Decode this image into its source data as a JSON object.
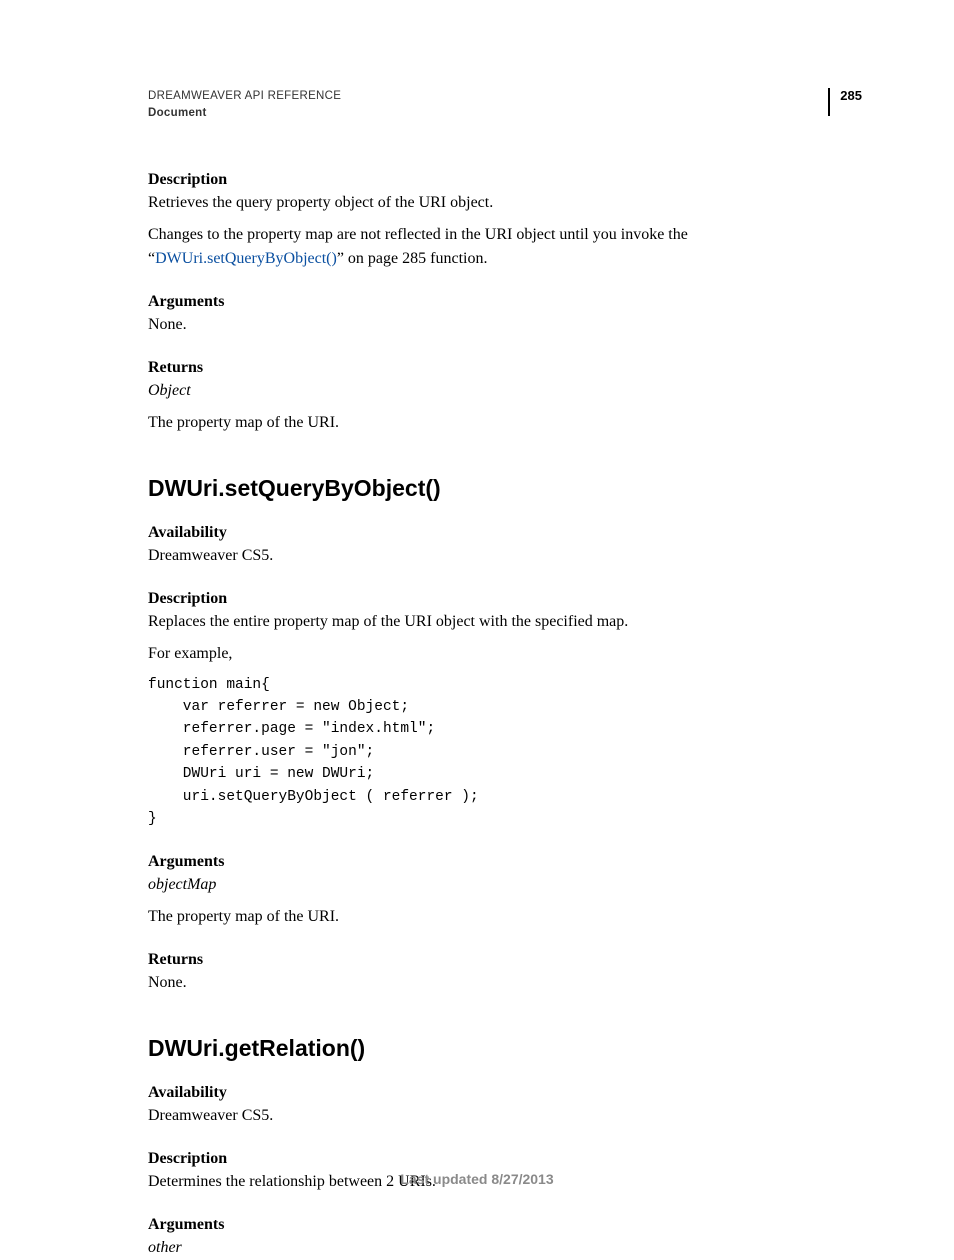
{
  "header": {
    "title": "DREAMWEAVER API REFERENCE",
    "section": "Document",
    "pageNumber": "285"
  },
  "block1": {
    "descriptionLabel": "Description",
    "descriptionText": "Retrieves the query property object of the URI object.",
    "changesPrefix": "Changes to the property map are not reflected in the URI object until you invoke the “",
    "changesLink": "DWUri.setQueryByObject()",
    "changesSuffix": "” on page 285 function.",
    "argumentsLabel": "Arguments",
    "argumentsText": "None.",
    "returnsLabel": "Returns",
    "returnsType": "Object",
    "returnsText": "The property map of the URI."
  },
  "block2": {
    "heading": "DWUri.setQueryByObject()",
    "availabilityLabel": "Availability",
    "availabilityText": "Dreamweaver CS5.",
    "descriptionLabel": "Description",
    "descriptionText": "Replaces the entire property map of the URI object with the specified map.",
    "forExample": "For example,",
    "code": "function main{\n    var referrer = new Object;\n    referrer.page = \"index.html\";\n    referrer.user = \"jon\";\n    DWUri uri = new DWUri;\n    uri.setQueryByObject ( referrer );\n}",
    "argumentsLabel": "Arguments",
    "argumentsType": "objectMap",
    "argumentsText": "The property map of the URI.",
    "returnsLabel": "Returns",
    "returnsText": "None."
  },
  "block3": {
    "heading": "DWUri.getRelation()",
    "availabilityLabel": "Availability",
    "availabilityText": "Dreamweaver CS5.",
    "descriptionLabel": "Description",
    "descriptionText": "Determines the relationship between 2 URIs.",
    "argumentsLabel": "Arguments",
    "argumentsType": "other"
  },
  "footer": {
    "text": "Last updated 8/27/2013"
  }
}
